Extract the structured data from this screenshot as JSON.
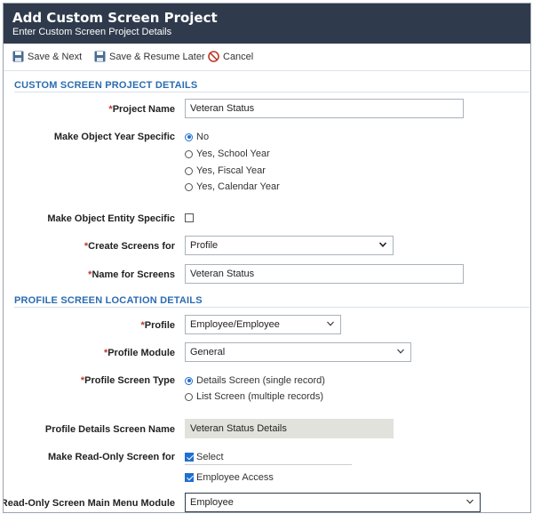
{
  "header": {
    "title": "Add Custom Screen Project",
    "subtitle": "Enter Custom Screen Project Details"
  },
  "toolbar": {
    "save_next": "Save & Next",
    "save_resume": "Save & Resume Later",
    "cancel": "Cancel"
  },
  "section1": {
    "title": "CUSTOM SCREEN PROJECT DETAILS",
    "project_name_label": "Project Name",
    "project_name_value": "Veteran Status",
    "year_specific_label": "Make Object Year Specific",
    "year_options": [
      "No",
      "Yes, School Year",
      "Yes, Fiscal Year",
      "Yes, Calendar Year"
    ],
    "year_selected": "No",
    "entity_specific_label": "Make Object Entity Specific",
    "entity_specific_checked": false,
    "create_screens_label": "Create Screens for",
    "create_screens_value": "Profile",
    "name_screens_label": "Name for Screens",
    "name_screens_value": "Veteran Status"
  },
  "section2": {
    "title": "PROFILE SCREEN LOCATION DETAILS",
    "profile_label": "Profile",
    "profile_value": "Employee/Employee",
    "module_label": "Profile Module",
    "module_value": "General",
    "screen_type_label": "Profile Screen Type",
    "screen_type_options": [
      "Details Screen (single record)",
      "List Screen (multiple records)"
    ],
    "screen_type_selected": "Details Screen (single record)",
    "details_name_label": "Profile Details Screen Name",
    "details_name_value": "Veteran Status Details",
    "readonly_label": "Make Read-Only Screen for",
    "readonly_options": [
      "Select",
      "Employee Access"
    ],
    "readonly_checked": [
      true,
      true
    ],
    "main_menu_label": "Read-Only Screen Main Menu Module",
    "main_menu_value": "Employee"
  },
  "colors": {
    "header_bg": "#2f3b4c",
    "section_title": "#2b6cb0",
    "required": "#c0392b",
    "accent": "#1f6fd1"
  }
}
